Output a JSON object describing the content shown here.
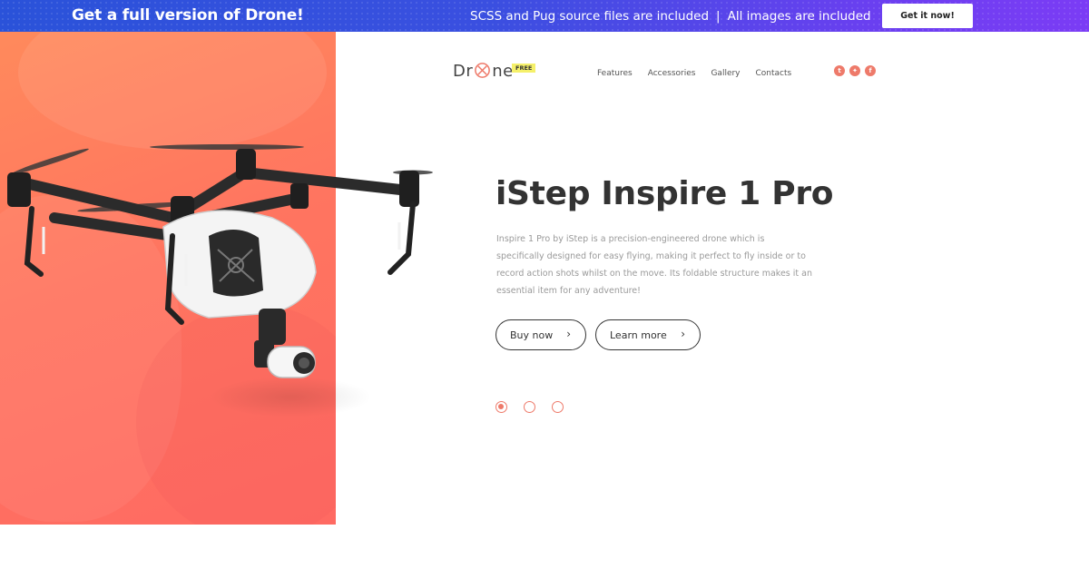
{
  "promo": {
    "title": "Get a full version of Drone!",
    "info_left": "SCSS and Pug source files are included",
    "separator": "|",
    "info_right": "All images are included",
    "cta": "Get it now!"
  },
  "brand": {
    "logo_prefix": "Dr",
    "logo_suffix": "ne",
    "badge": "FREE"
  },
  "nav": {
    "items": [
      {
        "label": "Features"
      },
      {
        "label": "Accessories"
      },
      {
        "label": "Gallery"
      },
      {
        "label": "Contacts"
      }
    ]
  },
  "social": {
    "items": [
      {
        "icon": "tumblr-icon",
        "glyph": "t"
      },
      {
        "icon": "twitter-icon",
        "glyph": "✦"
      },
      {
        "icon": "facebook-icon",
        "glyph": "f"
      }
    ]
  },
  "hero": {
    "title": "iStep Inspire 1 Pro",
    "description": "Inspire 1 Pro by iStep is a precision-engineered drone which is specifically designed for easy flying, making it perfect to fly inside or to record action shots whilst on the move. Its foldable structure makes it an essential item for any adventure!",
    "buy_label": "Buy now",
    "learn_label": "Learn more",
    "chevron": "›"
  },
  "slider": {
    "total": 3,
    "active": 1
  },
  "colors": {
    "accent": "#ee7a6a",
    "promo_start": "#2a52d9",
    "promo_end": "#7b3cf5",
    "panel": "#ff7560"
  }
}
